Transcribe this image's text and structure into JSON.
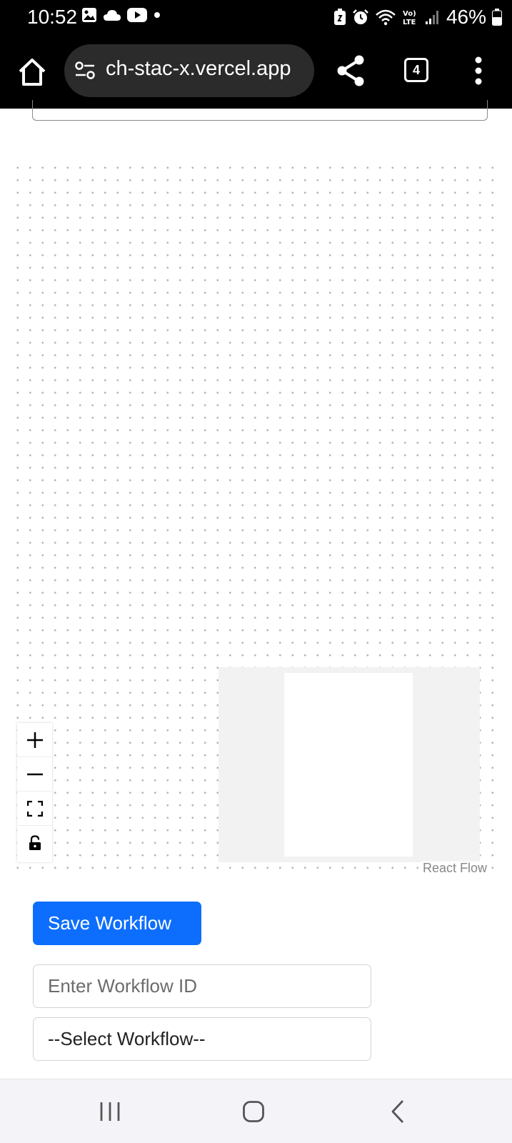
{
  "status_bar": {
    "time": "10:52",
    "battery_percent": "46%",
    "left_icons": [
      "gallery-icon",
      "cloud-icon",
      "youtube-icon",
      "dot-icon"
    ],
    "right_icons": [
      "battery-saver-icon",
      "alarm-icon",
      "wifi-icon",
      "volte-icon",
      "signal-icon",
      "battery-icon"
    ]
  },
  "browser": {
    "url": "ch-stac-x.vercel.app",
    "tab_count": "4"
  },
  "flow": {
    "attribution": "React Flow",
    "controls": [
      "zoom-in",
      "zoom-out",
      "fit-view",
      "lock"
    ]
  },
  "workflow": {
    "save_label": "Save Workflow",
    "id_placeholder": "Enter Workflow ID",
    "id_value": "",
    "select_value": "--Select Workflow--"
  },
  "colors": {
    "primary": "#0d6efd",
    "status_bar_bg": "#000000",
    "nav_bar_bg": "#f4f3f8",
    "minimap_bg": "#f2f2f2",
    "dot_grid": "#b4b4b4"
  }
}
